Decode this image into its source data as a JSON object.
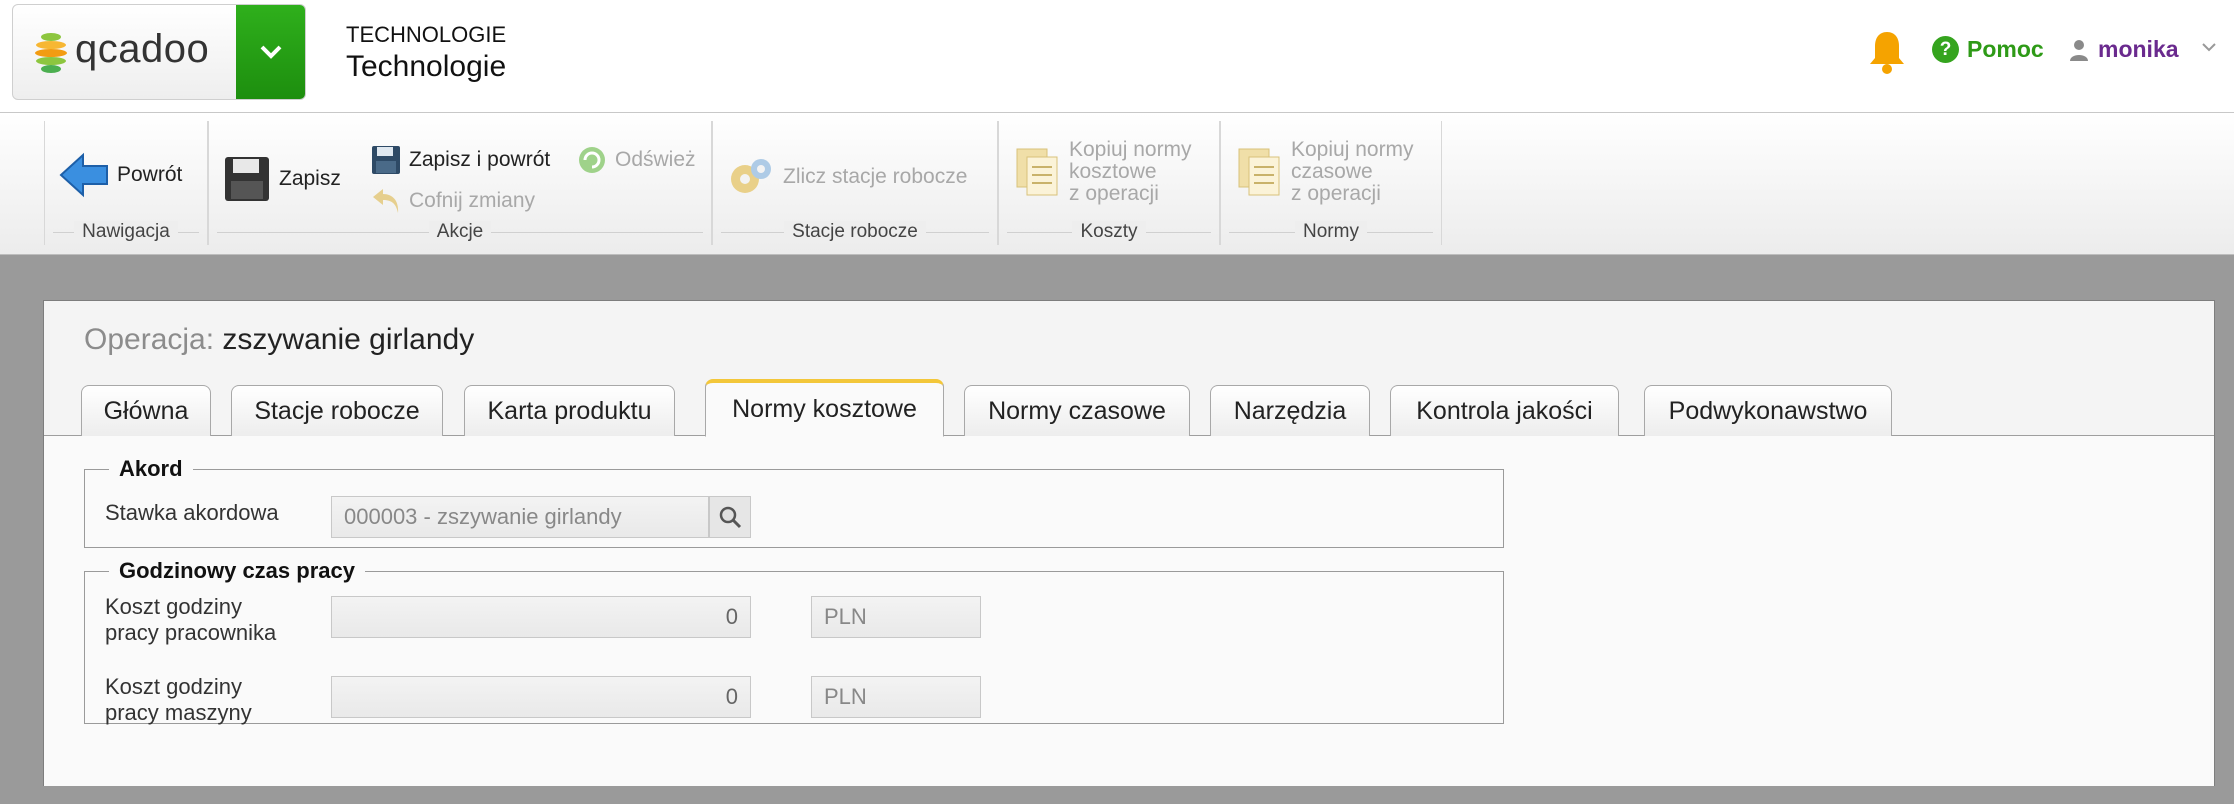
{
  "header": {
    "logo_text": "qcadoo",
    "subtitle": "TECHNOLOGIE",
    "title": "Technologie",
    "help_label": "Pomoc",
    "user_name": "monika"
  },
  "ribbon": {
    "groups": {
      "nav": "Nawigacja",
      "actions": "Akcje",
      "stations": "Stacje robocze",
      "costs": "Koszty",
      "norms": "Normy"
    },
    "back_label": "Powrót",
    "save_label": "Zapisz",
    "save_back_label": "Zapisz i powrót",
    "refresh_label": "Odśwież",
    "undo_label": "Cofnij zmiany",
    "count_stations_label": "Zlicz stacje robocze",
    "copy_cost_line1": "Kopiuj normy",
    "copy_cost_line2": "kosztowe",
    "copy_cost_line3": "z operacji",
    "copy_time_line1": "Kopiuj normy",
    "copy_time_line2": "czasowe",
    "copy_time_line3": "z operacji"
  },
  "form": {
    "title_label": "Operacja:",
    "title_value": "zszywanie girlandy",
    "tabs": [
      {
        "label": "Główna"
      },
      {
        "label": "Stacje robocze"
      },
      {
        "label": "Karta produktu"
      },
      {
        "label": "Normy kosztowe"
      },
      {
        "label": "Normy czasowe"
      },
      {
        "label": "Narzędzia"
      },
      {
        "label": "Kontrola jakości"
      },
      {
        "label": "Podwykonawstwo"
      }
    ],
    "active_tab": "Normy kosztowe",
    "piecework": {
      "legend": "Akord",
      "rate_label": "Stawka akordowa",
      "rate_value": "000003 - zszywanie girlandy"
    },
    "hourly": {
      "legend": "Godzinowy czas pracy",
      "worker_label_1": "Koszt godziny",
      "worker_label_2": "pracy pracownika",
      "worker_value": "0",
      "worker_currency": "PLN",
      "machine_label_1": "Koszt godziny",
      "machine_label_2": "pracy maszyny",
      "machine_value": "0",
      "machine_currency": "PLN"
    }
  },
  "colors": {
    "accent_green": "#2fb01c",
    "active_tab": "#f3c73a",
    "user": "#6a2a8e",
    "bell": "#f5a300"
  }
}
